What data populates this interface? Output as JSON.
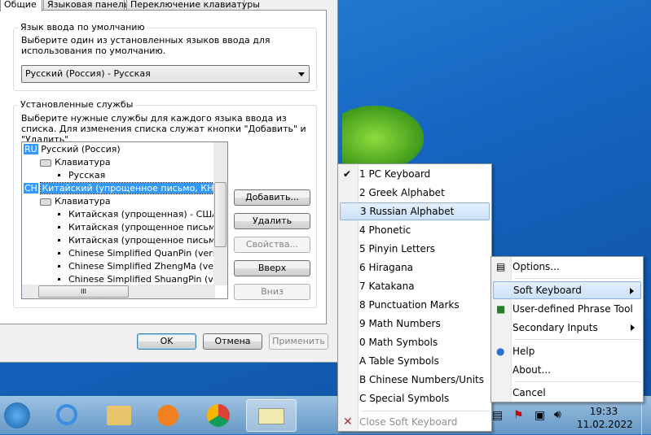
{
  "dialog": {
    "tabs": [
      "Общие",
      "Языковая панель",
      "Переключение клавиатуры"
    ],
    "default_group": {
      "legend": "Язык ввода по умолчанию",
      "description": "Выберите один из установленных языков ввода для использования по умолчанию.",
      "selected": "Русский (Россия) - Русская"
    },
    "services_group": {
      "legend": "Установленные службы",
      "description": "Выберите нужные службы для каждого языка ввода из списка. Для изменения списка служат кнопки \"Добавить\" и \"Удалить\".",
      "tree": [
        {
          "badge": "RU",
          "label": "Русский (Россия)",
          "level": 0
        },
        {
          "label": "Клавиатура",
          "level": 1
        },
        {
          "label": "Русская",
          "level": 2
        },
        {
          "badge": "CH",
          "label": "Китайский (упрощенное письмо, КНР)",
          "level": 0,
          "selected": true
        },
        {
          "label": "Клавиатура",
          "level": 1
        },
        {
          "label": "Китайская (упрощенная) - США",
          "level": 2
        },
        {
          "label": "Китайская (упрощенное письмо) -",
          "level": 2
        },
        {
          "label": "Китайская (упрощенное письмо) -",
          "level": 2
        },
        {
          "label": "Chinese Simplified QuanPin (version",
          "level": 2
        },
        {
          "label": "Chinese Simplified ZhengMa (version",
          "level": 2
        },
        {
          "label": "Chinese Simplified ShuangPin (versic",
          "level": 2
        }
      ],
      "hscroll_grip": "III",
      "buttons": {
        "add": "Добавить...",
        "remove": "Удалить",
        "properties": "Свойства...",
        "up": "Вверх",
        "down": "Вниз"
      }
    },
    "footer": {
      "ok": "OK",
      "cancel": "Отмена",
      "apply": "Применить"
    }
  },
  "soft_keyboard_menu": {
    "items": [
      "1 PC Keyboard",
      "2 Greek Alphabet",
      "3 Russian Alphabet",
      "4 Phonetic",
      "5 Pinyin Letters",
      "6 Hiragana",
      "7 Katakana",
      "8 Punctuation Marks",
      "9 Math Numbers",
      "0 Math Symbols",
      "A Table Symbols",
      "B Chinese Numbers/Units",
      "C Special Symbols"
    ],
    "checked": "1 PC Keyboard",
    "highlighted": "3 Russian Alphabet",
    "close": "Close Soft Keyboard"
  },
  "context_menu": {
    "options": "Options...",
    "soft_keyboard": "Soft Keyboard",
    "phrase_tool": "User-defined Phrase Tool",
    "secondary_inputs": "Secondary Inputs",
    "help": "Help",
    "about": "About...",
    "cancel": "Cancel"
  },
  "taskbar": {
    "apps": [
      "start",
      "internet-explorer",
      "file-explorer",
      "media-player",
      "chrome",
      "language-bar"
    ],
    "time": "19:33",
    "date": "11.02.2022"
  }
}
